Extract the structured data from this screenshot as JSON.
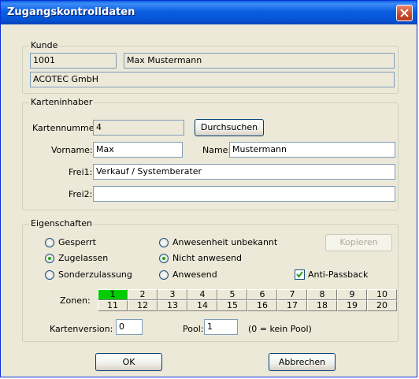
{
  "window": {
    "title": "Zugangskontrolldaten"
  },
  "kunde": {
    "legend": "Kunde",
    "nummer": "1001",
    "name": "Max Mustermann",
    "firma": "ACOTEC GmbH"
  },
  "karteninhaber": {
    "legend": "Karteninhaber",
    "kartennummer_label": "Kartennummer:",
    "kartennummer": "4",
    "durchsuchen": "Durchsuchen",
    "vorname_label": "Vorname:",
    "vorname": "Max",
    "name_label": "Name:",
    "name": "Mustermann",
    "frei1_label": "Frei1:",
    "frei1": "Verkauf / Systemberater",
    "frei2_label": "Frei2:",
    "frei2": ""
  },
  "eigenschaften": {
    "legend": "Eigenschaften",
    "gesperrt": "Gesperrt",
    "zugelassen": "Zugelassen",
    "sonderzulassung": "Sonderzulassung",
    "anwesenheit_unbekannt": "Anwesenheit unbekannt",
    "nicht_anwesend": "Nicht anwesend",
    "anwesend": "Anwesend",
    "kopieren": "Kopieren",
    "anti_passback": "Anti-Passback",
    "zonen_label": "Zonen:",
    "zonen_row1": [
      "1",
      "2",
      "3",
      "4",
      "5",
      "6",
      "7",
      "8",
      "9",
      "10"
    ],
    "zonen_row2": [
      "11",
      "12",
      "13",
      "14",
      "15",
      "16",
      "17",
      "18",
      "19",
      "20"
    ],
    "active_zone": "1",
    "kartenversion_label": "Kartenversion:",
    "kartenversion": "0",
    "pool_label": "Pool:",
    "pool": "1",
    "pool_hint": "(0 = kein Pool)"
  },
  "footer": {
    "ok": "OK",
    "abbrechen": "Abbrechen"
  },
  "colors": {
    "title_bar": "#0553d6",
    "dialog_bg": "#ece9d8",
    "active_zone": "#00cc00"
  }
}
